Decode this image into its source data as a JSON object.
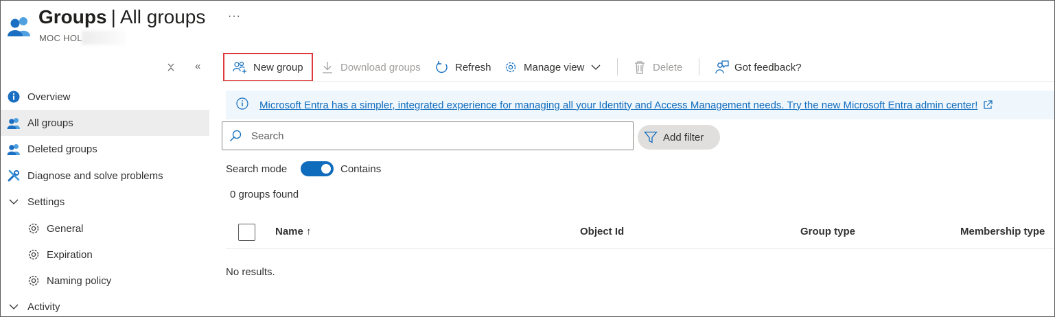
{
  "header": {
    "title_main": "Groups",
    "title_separator": "|",
    "title_sub": "All groups",
    "more_label": "···",
    "subtitle": "MOC HOL"
  },
  "sidebar": {
    "pin_label": "⌅",
    "collapse_label": "«",
    "items": [
      {
        "label": "Overview",
        "icon": "info-icon"
      },
      {
        "label": "All groups",
        "icon": "group-icon"
      },
      {
        "label": "Deleted groups",
        "icon": "group-icon"
      },
      {
        "label": "Diagnose and solve problems",
        "icon": "wrench-icon"
      },
      {
        "label": "Settings",
        "icon": "chevron-down-icon"
      },
      {
        "label": "General",
        "icon": "gear-icon"
      },
      {
        "label": "Expiration",
        "icon": "gear-icon"
      },
      {
        "label": "Naming policy",
        "icon": "gear-icon"
      },
      {
        "label": "Activity",
        "icon": "chevron-down-icon"
      }
    ]
  },
  "toolbar": {
    "new_group": "New group",
    "download_groups": "Download groups",
    "refresh": "Refresh",
    "manage_view": "Manage view",
    "delete": "Delete",
    "feedback": "Got feedback?"
  },
  "banner": {
    "text": "Microsoft Entra has a simpler, integrated experience for managing all your Identity and Access Management needs. Try the new Microsoft Entra admin center!"
  },
  "search": {
    "placeholder": "Search",
    "add_filter": "Add filter",
    "mode_label": "Search mode",
    "mode_value": "Contains",
    "mode_on": true
  },
  "results": {
    "count_text": "0 groups found",
    "empty_text": "No results."
  },
  "table": {
    "columns": [
      "Name ↑",
      "Object Id",
      "Group type",
      "Membership type"
    ]
  },
  "colors": {
    "accent": "#0f6cbd",
    "highlight_border": "#e0383e",
    "banner_bg": "#eff6fc",
    "selected_bg": "#ededed"
  }
}
